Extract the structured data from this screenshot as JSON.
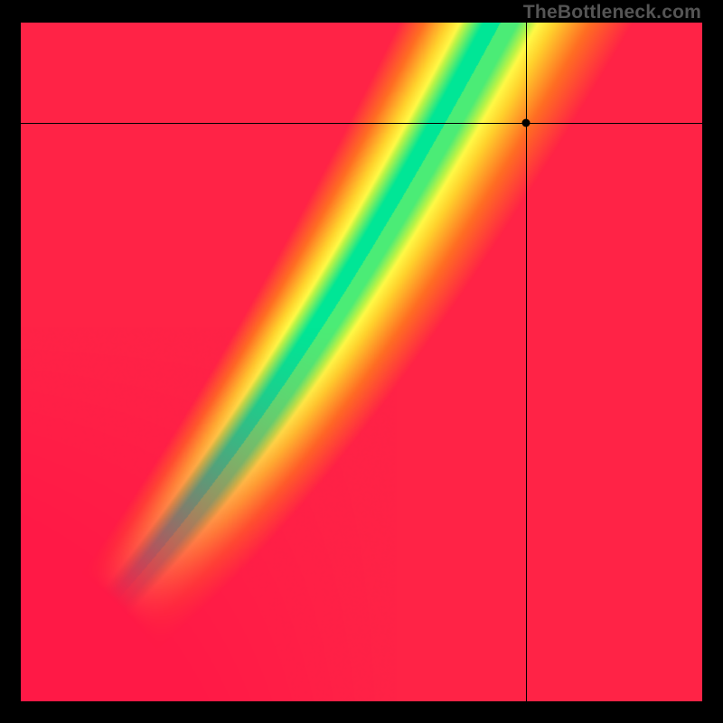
{
  "domain": "Chart",
  "watermark": "TheBottleneck.com",
  "chart_data": {
    "type": "heatmap",
    "title": "",
    "xlabel": "",
    "ylabel": "",
    "xlim": [
      0,
      1
    ],
    "ylim": [
      0,
      1
    ],
    "crosshair": {
      "x": 0.742,
      "y": 0.852
    },
    "marker": {
      "x": 0.742,
      "y": 0.852
    },
    "optimal_curve_notes": "Green diagonal band roughly from (0,0) to ~(0.8,1); point sits at upper edge of balanced region.",
    "field": "continuous red→orange→yellow→green gradient; green along S-curved diagonal band, red in far corners away from band",
    "legend": null,
    "annotations": [],
    "grid": false
  }
}
